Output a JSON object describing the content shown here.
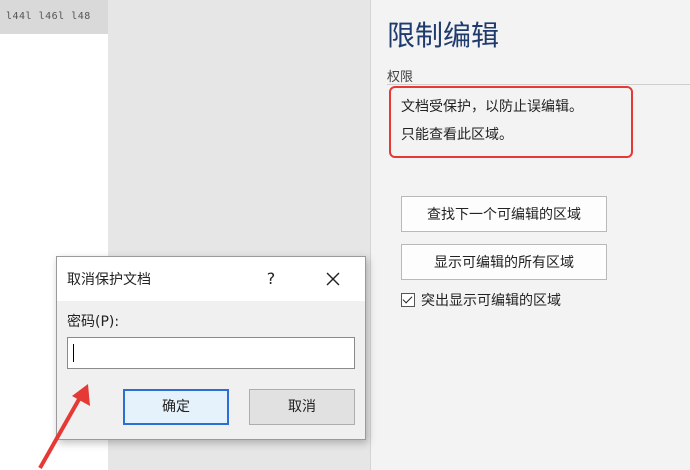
{
  "ruler": {
    "ticks_text": "l44l  l46l  l48"
  },
  "pane": {
    "title": "限制编辑",
    "permissions_label": "权限",
    "permission_lines": [
      "文档受保护，以防止误编辑。",
      "只能查看此区域。"
    ],
    "buttons": {
      "find_next": "查找下一个可编辑的区域",
      "show_all": "显示可编辑的所有区域"
    },
    "highlight_checkbox": {
      "label": "突出显示可编辑的区域",
      "checked": true
    }
  },
  "dialog": {
    "title": "取消保护文档",
    "help_label": "?",
    "password_label": "密码(P):",
    "password_value": "",
    "ok_label": "确定",
    "cancel_label": "取消"
  },
  "colors": {
    "pane_title": "#1f3b6e",
    "annotation_red": "#e53935",
    "primary_border": "#2b6fd6"
  }
}
